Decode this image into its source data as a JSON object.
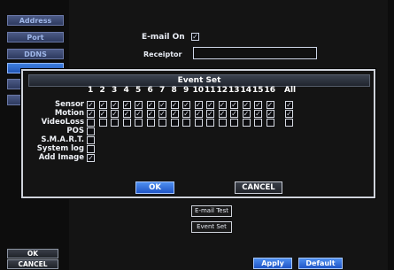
{
  "sidebar": {
    "items": [
      "Address",
      "Port",
      "DDNS",
      "",
      "",
      ""
    ]
  },
  "email": {
    "on_label": "E-mail On",
    "on_checked": true,
    "receiptor_label": "Receiptor",
    "receiptor_value": ""
  },
  "event_set": {
    "title": "Event Set",
    "channels": [
      "1",
      "2",
      "3",
      "4",
      "5",
      "6",
      "7",
      "8",
      "9",
      "10",
      "11",
      "12",
      "13",
      "14",
      "15",
      "16"
    ],
    "all_label": "All",
    "rows": [
      {
        "label": "Sensor",
        "checks": [
          true,
          true,
          true,
          true,
          true,
          true,
          true,
          true,
          true,
          true,
          true,
          true,
          true,
          true,
          true,
          true
        ],
        "all": true
      },
      {
        "label": "Motion",
        "checks": [
          true,
          true,
          true,
          true,
          true,
          true,
          true,
          true,
          true,
          true,
          true,
          true,
          true,
          true,
          true,
          true
        ],
        "all": true
      },
      {
        "label": "VideoLoss",
        "checks": [
          false,
          false,
          false,
          false,
          false,
          false,
          false,
          false,
          false,
          false,
          false,
          false,
          false,
          false,
          false,
          false
        ],
        "all": false
      },
      {
        "label": "POS",
        "checks": [
          false
        ],
        "all": null
      },
      {
        "label": "S.M.A.R.T.",
        "checks": [
          false
        ],
        "all": null
      },
      {
        "label": "System log",
        "checks": [
          false
        ],
        "all": null
      },
      {
        "label": "Add Image",
        "checks": [
          true
        ],
        "all": null
      }
    ],
    "ok_label": "OK",
    "cancel_label": "CANCEL"
  },
  "actions": {
    "email_test": "E-mail Test",
    "event_set": "Event Set"
  },
  "bottom": {
    "ok": "OK",
    "cancel": "CANCEL",
    "apply": "Apply",
    "default": "Default"
  }
}
